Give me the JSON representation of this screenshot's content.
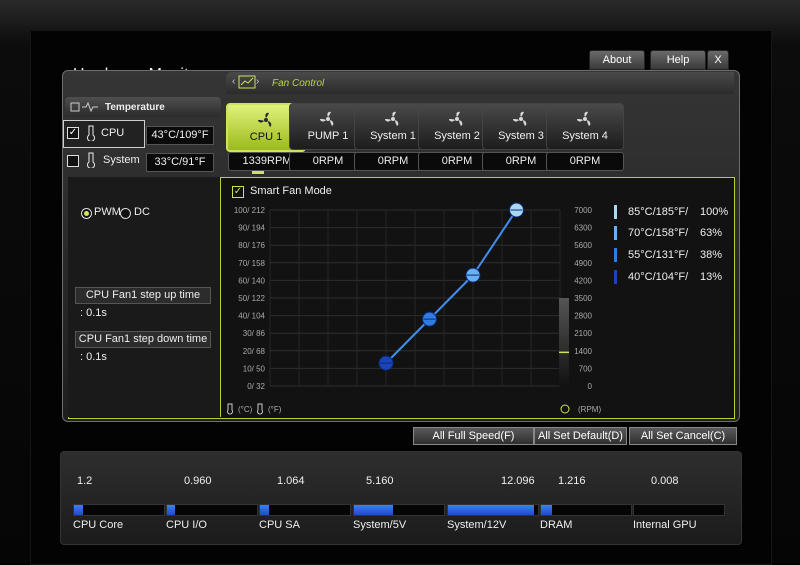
{
  "app": {
    "title": "Hardware Monitor"
  },
  "top_buttons": {
    "about": "About",
    "help": "Help",
    "close": "X"
  },
  "section_tab": {
    "label": "Fan Control"
  },
  "temperature": {
    "title": "Temperature",
    "sensors": [
      {
        "name": "CPU",
        "value": "43°C/109°F",
        "checked": true
      },
      {
        "name": "System",
        "value": "33°C/91°F",
        "checked": false
      }
    ]
  },
  "fans": [
    {
      "name": "CPU 1",
      "rpm": "1339RPM",
      "active": true
    },
    {
      "name": "PUMP 1",
      "rpm": "0RPM",
      "active": false
    },
    {
      "name": "System 1",
      "rpm": "0RPM",
      "active": false
    },
    {
      "name": "System 2",
      "rpm": "0RPM",
      "active": false
    },
    {
      "name": "System 3",
      "rpm": "0RPM",
      "active": false
    },
    {
      "name": "System 4",
      "rpm": "0RPM",
      "active": false
    }
  ],
  "mode": {
    "pwm": "PWM",
    "dc": "DC",
    "selected": "PWM"
  },
  "smart_fan": {
    "label": "Smart Fan Mode",
    "checked": true
  },
  "step_up": {
    "label": "CPU Fan1 step up time",
    "value": ": 0.1s"
  },
  "step_down": {
    "label": "CPU Fan1 step down time",
    "value": ": 0.1s"
  },
  "legend": [
    {
      "temp": "85°C/185°F/",
      "pct": "100%",
      "color": "#a9d8f5"
    },
    {
      "temp": "70°C/158°F/",
      "pct": "63%",
      "color": "#6ab0f0"
    },
    {
      "temp": "55°C/131°F/",
      "pct": "38%",
      "color": "#2f7be0"
    },
    {
      "temp": "40°C/104°F/",
      "pct": "13%",
      "color": "#1a44b8"
    }
  ],
  "axis_units": {
    "temp": "(°C)",
    "temp_f": "(°F)",
    "rpm": "(RPM)"
  },
  "chart_data": {
    "type": "line",
    "title": "",
    "y_left_ticks": [
      "100/ 212",
      "90/ 194",
      "80/ 176",
      "70/ 158",
      "60/ 140",
      "50/ 122",
      "40/ 104",
      "30/ 86",
      "20/ 68",
      "10/ 50",
      "0/ 32"
    ],
    "y_right_ticks": [
      "7000",
      "6300",
      "5600",
      "4900",
      "4200",
      "3500",
      "2800",
      "2100",
      "1400",
      "700",
      "0"
    ],
    "x_range": [
      0,
      100
    ],
    "y_range": [
      0,
      100
    ],
    "points": [
      {
        "x": 40,
        "y": 13,
        "color": "#1a44b8"
      },
      {
        "x": 55,
        "y": 38,
        "color": "#2f7be0"
      },
      {
        "x": 70,
        "y": 63,
        "color": "#6ab0f0"
      },
      {
        "x": 85,
        "y": 100,
        "color": "#a9d8f5"
      }
    ],
    "current_rpm": 1339,
    "grid": true
  },
  "bottom_buttons": {
    "full_speed": "All Full Speed(F)",
    "set_default": "All Set Default(D)",
    "set_cancel": "All Set Cancel(C)"
  },
  "voltages": [
    {
      "name": "CPU Core",
      "value": "1.2",
      "level": 0.1
    },
    {
      "name": "CPU I/O",
      "value": "0.960",
      "level": 0.09
    },
    {
      "name": "CPU SA",
      "value": "1.064",
      "level": 0.1
    },
    {
      "name": "System/5V",
      "value": "5.160",
      "level": 0.43
    },
    {
      "name": "System/12V",
      "value": "12.096",
      "level": 0.96
    },
    {
      "name": "DRAM",
      "value": "1.216",
      "level": 0.12
    },
    {
      "name": "Internal GPU",
      "value": "0.008",
      "level": 0.0
    }
  ]
}
